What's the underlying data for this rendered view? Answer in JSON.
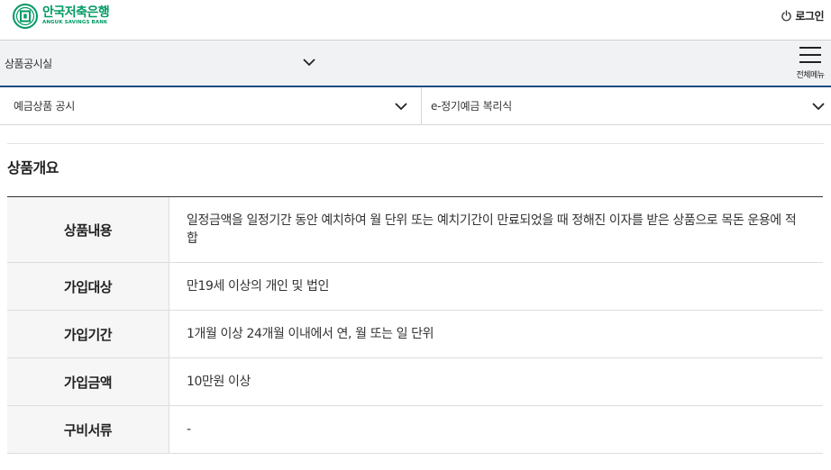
{
  "header": {
    "logo_ko": "안국저축은행",
    "logo_en": "ANGUK SAVINGS BANK",
    "login_label": "로그인"
  },
  "nav": {
    "menu1_label": "상품공시실",
    "all_menu_label": "전체메뉴",
    "dropdown_left": "예금상품 공시",
    "dropdown_right": "e-정기예금 복리식"
  },
  "main": {
    "section_title": "상품개요",
    "rows": [
      {
        "label": "상품내용",
        "value": "일정금액을 일정기간 동안 예치하여 월 단위 또는 예치기간이 만료되었을 때 정해진 이자를 받은 상품으로 목돈 운용에 적합"
      },
      {
        "label": "가입대상",
        "value": "만19세 이상의 개인 및 법인"
      },
      {
        "label": "가입기간",
        "value": "1개월 이상 24개월 이내에서 연, 월 또는 일 단위"
      },
      {
        "label": "가입금액",
        "value": "10만원 이상"
      },
      {
        "label": "구비서류",
        "value": "-"
      }
    ]
  },
  "colors": {
    "brand_green": "#009a63",
    "nav_accent": "#1b4f80"
  }
}
